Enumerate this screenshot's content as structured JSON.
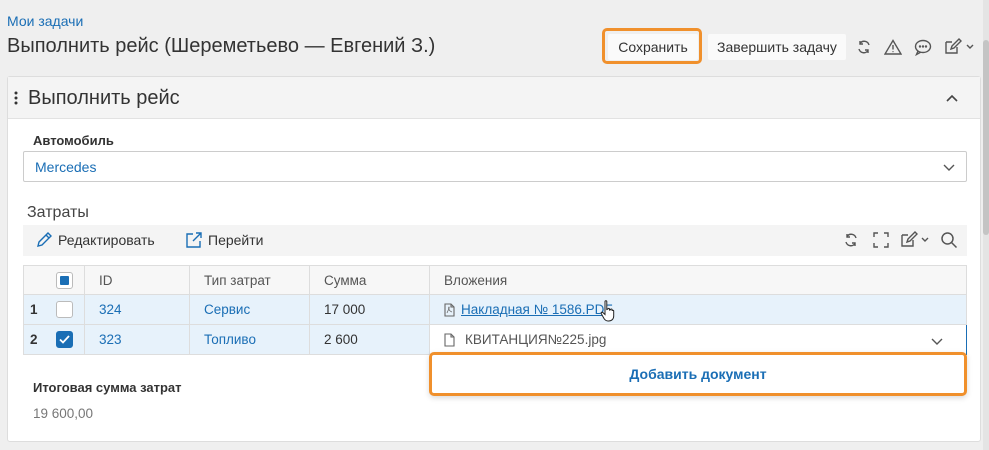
{
  "breadcrumb": "Мои задачи",
  "page_title": "Выполнить рейс (Шереметьево — Евгений З.)",
  "toolbar": {
    "save_label": "Сохранить",
    "finish_label": "Завершить задачу"
  },
  "panel": {
    "title": "Выполнить рейс"
  },
  "vehicle": {
    "label": "Автомобиль",
    "value": "Mercedes"
  },
  "expenses": {
    "title": "Затраты",
    "edit_label": "Редактировать",
    "goto_label": "Перейти",
    "columns": [
      "ID",
      "Тип затрат",
      "Сумма",
      "Вложения"
    ],
    "rows": [
      {
        "num": "1",
        "id": "324",
        "type": "Сервис",
        "sum": "17 000",
        "attachment": "Накладная № 1586.PDF",
        "checked": false
      },
      {
        "num": "2",
        "id": "323",
        "type": "Топливо",
        "sum": "2 600",
        "attachment": "КВИТАНЦИЯ№225.jpg",
        "checked": true
      }
    ],
    "add_document_label": "Добавить документ"
  },
  "total": {
    "label": "Итоговая сумма затрат",
    "value": "19 600,00"
  },
  "colors": {
    "accent": "#1a6eb5",
    "highlight": "#f0902c",
    "selected_row": "#e7f2fb"
  },
  "icons": [
    "refresh-icon",
    "warning-icon",
    "comment-icon",
    "edit-icon",
    "chevron-up-icon",
    "chevron-down-icon",
    "pencil-icon",
    "external-link-icon",
    "fullscreen-icon",
    "search-icon",
    "pdf-file-icon",
    "file-icon",
    "hand-cursor-icon",
    "checkmark-icon"
  ]
}
